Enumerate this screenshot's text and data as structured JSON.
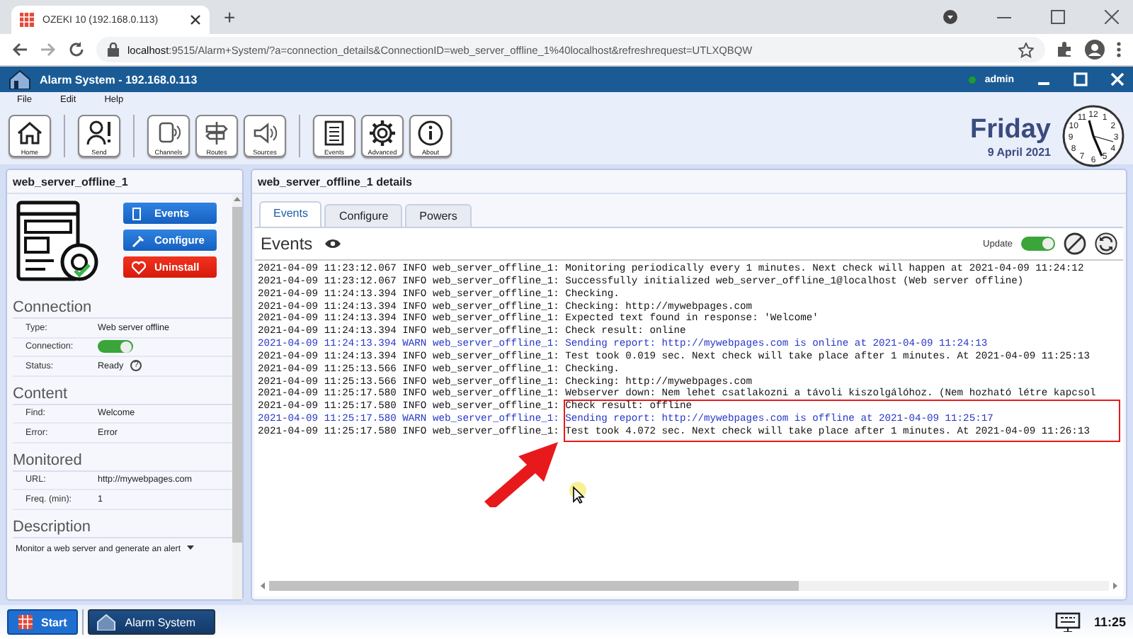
{
  "browser": {
    "tab_title": "OZEKI 10 (192.168.0.113)",
    "new_tab": "+",
    "url_host": "localhost",
    "url_rest": ":9515/Alarm+System/?a=connection_details&ConnectionID=web_server_offline_1%40localhost&refreshrequest=UTLXQBQW"
  },
  "app": {
    "title": "Alarm System - 192.168.0.113",
    "user": "admin",
    "user_online": true
  },
  "menu": [
    "File",
    "Edit",
    "Help"
  ],
  "toolbar": [
    {
      "label": "Home"
    },
    {
      "label": "Send"
    },
    {
      "label": "Channels"
    },
    {
      "label": "Routes"
    },
    {
      "label": "Sources"
    },
    {
      "label": "Events"
    },
    {
      "label": "Advanced"
    },
    {
      "label": "About"
    }
  ],
  "date": {
    "day": "Friday",
    "date": "9 April 2021"
  },
  "clock_numbers": [
    "11",
    "12",
    "1",
    "10",
    "2",
    "9",
    "3",
    "8",
    "4",
    "7",
    "5",
    "6"
  ],
  "sidebar": {
    "title": "web_server_offline_1",
    "actions": [
      {
        "label": "Events",
        "kind": "events"
      },
      {
        "label": "Configure",
        "kind": "configure"
      },
      {
        "label": "Uninstall",
        "kind": "uninstall"
      }
    ],
    "sections": [
      {
        "title": "Connection",
        "rows": [
          {
            "label": "Type:",
            "kind": "text",
            "value": "Web server offline"
          },
          {
            "label": "Connection:",
            "kind": "toggle",
            "on": true
          },
          {
            "label": "Status:",
            "kind": "help",
            "value": "Ready",
            "help": "?"
          }
        ]
      },
      {
        "title": "Content",
        "rows": [
          {
            "label": "Find:",
            "kind": "text",
            "value": "Welcome"
          },
          {
            "label": "Error:",
            "kind": "text",
            "value": "Error"
          }
        ]
      },
      {
        "title": "Monitored",
        "rows": [
          {
            "label": "URL:",
            "kind": "text",
            "value": "http://mywebpages.com"
          },
          {
            "label": "Freq. (min):",
            "kind": "text",
            "value": "1"
          }
        ]
      },
      {
        "title": "Description",
        "note": "Monitor a web server and generate an alert"
      }
    ]
  },
  "details": {
    "title": "web_server_offline_1 details",
    "tabs": [
      {
        "label": "Events",
        "selected": true
      },
      {
        "label": "Configure",
        "selected": false
      },
      {
        "label": "Powers",
        "selected": false
      }
    ],
    "events_title": "Events",
    "update_label": "Update",
    "update_on": true,
    "log": [
      {
        "kind": "info",
        "text": "2021-04-09 11:23:12.067 INFO web_server_offline_1: Monitoring periodically every 1 minutes. Next check will happen at 2021-04-09 11:24:12"
      },
      {
        "kind": "info",
        "text": "2021-04-09 11:23:12.067 INFO web_server_offline_1: Successfully initialized web_server_offline_1@localhost (Web server offline)"
      },
      {
        "kind": "info",
        "text": "2021-04-09 11:24:13.394 INFO web_server_offline_1: Checking."
      },
      {
        "kind": "info",
        "text": "2021-04-09 11:24:13.394 INFO web_server_offline_1: Checking: http://mywebpages.com"
      },
      {
        "kind": "info",
        "text": "2021-04-09 11:24:13.394 INFO web_server_offline_1: Expected text found in response: 'Welcome'"
      },
      {
        "kind": "info",
        "text": "2021-04-09 11:24:13.394 INFO web_server_offline_1: Check result: online"
      },
      {
        "kind": "warn",
        "text": "2021-04-09 11:24:13.394 WARN web_server_offline_1: Sending report: http://mywebpages.com is online at 2021-04-09 11:24:13"
      },
      {
        "kind": "info",
        "text": "2021-04-09 11:24:13.394 INFO web_server_offline_1: Test took 0.019 sec. Next check will take place after 1 minutes. At 2021-04-09 11:25:13"
      },
      {
        "kind": "info",
        "text": "2021-04-09 11:25:13.566 INFO web_server_offline_1: Checking."
      },
      {
        "kind": "info",
        "text": "2021-04-09 11:25:13.566 INFO web_server_offline_1: Checking: http://mywebpages.com"
      },
      {
        "kind": "info",
        "text": "2021-04-09 11:25:17.580 INFO web_server_offline_1: Webserver down: Nem lehet csatlakozni a távoli kiszolgálóhoz. (Nem hozható létre kapcsol"
      },
      {
        "kind": "info",
        "text": "2021-04-09 11:25:17.580 INFO web_server_offline_1: Check result: offline"
      },
      {
        "kind": "warn",
        "text": "2021-04-09 11:25:17.580 WARN web_server_offline_1: Sending report: http://mywebpages.com is offline at 2021-04-09 11:25:17"
      },
      {
        "kind": "info",
        "text": "2021-04-09 11:25:17.580 INFO web_server_offline_1: Test took 4.072 sec. Next check will take place after 1 minutes. At 2021-04-09 11:26:13"
      }
    ]
  },
  "taskbar": {
    "start": "Start",
    "apps": [
      {
        "label": "Alarm System",
        "selected": true
      }
    ],
    "time": "11:25"
  }
}
